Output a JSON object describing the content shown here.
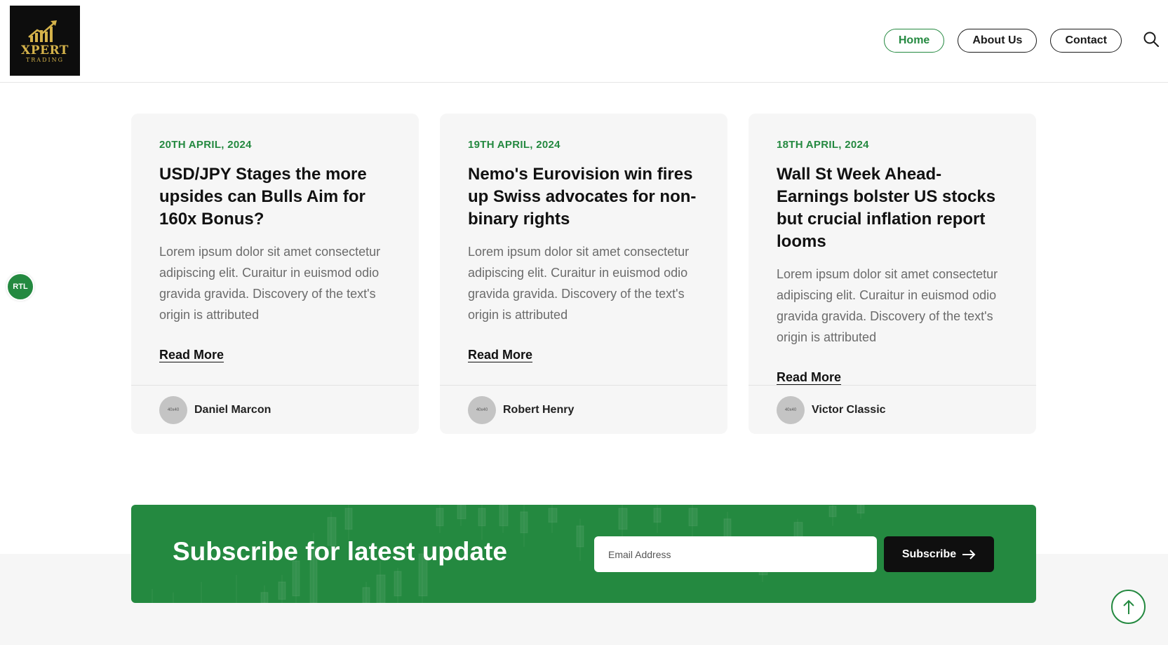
{
  "header": {
    "logo": {
      "title": "XPERT",
      "subtitle": "TRADING"
    },
    "nav": [
      {
        "label": "Home",
        "active": true
      },
      {
        "label": "About Us",
        "active": false
      },
      {
        "label": "Contact",
        "active": false
      }
    ],
    "search_icon": "search-icon"
  },
  "rtl_badge": "RTL",
  "posts": [
    {
      "date": "20TH APRIL, 2024",
      "title": "USD/JPY Stages the more upsides can Bulls Aim for 160x Bonus?",
      "excerpt": "Lorem ipsum dolor sit amet consectetur adipiscing elit. Curaitur in euismod odio gravida gravida. Discovery of the text's origin is attributed",
      "link": "Read More",
      "avatar": "40x40",
      "author": "Daniel Marcon"
    },
    {
      "date": "19TH APRIL, 2024",
      "title": "Nemo's Eurovision win fires up Swiss advocates for non-binary rights",
      "excerpt": "Lorem ipsum dolor sit amet consectetur adipiscing elit. Curaitur in euismod odio gravida gravida. Discovery of the text's origin is attributed",
      "link": "Read More",
      "avatar": "40x40",
      "author": "Robert Henry"
    },
    {
      "date": "18TH APRIL, 2024",
      "title": "Wall St Week Ahead-Earnings bolster US stocks but crucial inflation report looms",
      "excerpt": "Lorem ipsum dolor sit amet consectetur adipiscing elit. Curaitur in euismod odio gravida gravida. Discovery of the text's origin is attributed",
      "link": "Read More",
      "avatar": "40x40",
      "author": "Victor Classic"
    }
  ],
  "subscribe": {
    "title": "Subscribe for latest update",
    "email_placeholder": "Email Address",
    "button_label": "Subscribe",
    "button_icon": "arrow-right-icon"
  },
  "back_to_top_icon": "arrow-up-icon",
  "colors": {
    "accent": "#248940",
    "dark": "#0f0f0f",
    "card_bg": "#f6f6f6"
  }
}
